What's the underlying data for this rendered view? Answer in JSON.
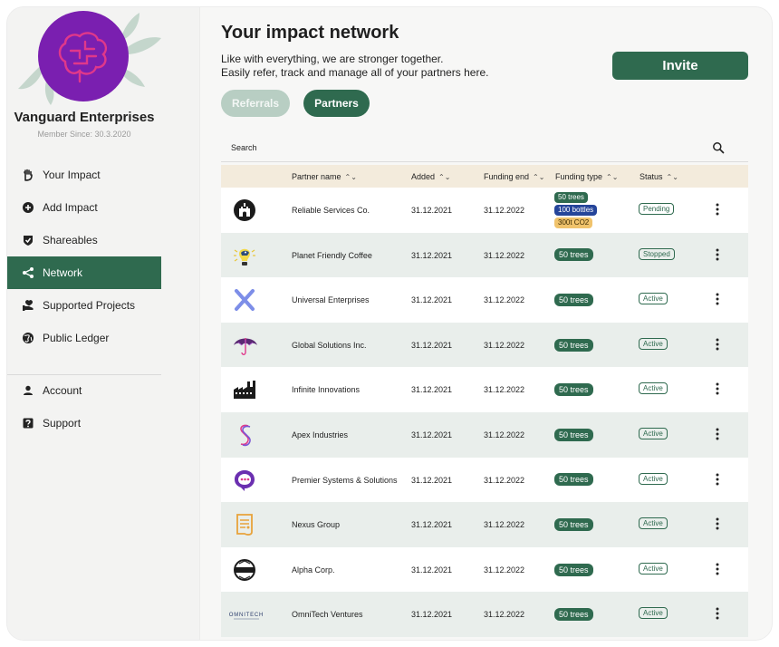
{
  "sidebar": {
    "company_name": "Vanguard Enterprises",
    "member_since": "Member Since: 30.3.2020",
    "nav": [
      {
        "label": "Your Impact",
        "icon": "hand-icon"
      },
      {
        "label": "Add Impact",
        "icon": "plus-circle-icon"
      },
      {
        "label": "Shareables",
        "icon": "shield-check-icon"
      },
      {
        "label": "Network",
        "icon": "share-icon",
        "active": true
      },
      {
        "label": "Supported Projects",
        "icon": "heart-hand-icon"
      },
      {
        "label": "Public Ledger",
        "icon": "globe-icon"
      }
    ],
    "nav_secondary": [
      {
        "label": "Account",
        "icon": "user-icon"
      },
      {
        "label": "Support",
        "icon": "help-icon"
      }
    ]
  },
  "main": {
    "title": "Your impact network",
    "subtitle_line1": "Like with everything, we are stronger together.",
    "subtitle_line2": "Easily refer, track and manage all of your partners here.",
    "invite_label": "Invite",
    "tabs": [
      {
        "label": "Referrals",
        "active": false
      },
      {
        "label": "Partners",
        "active": true
      }
    ],
    "search_label": "Search"
  },
  "table": {
    "columns": [
      "Partner name",
      "Added",
      "Funding end",
      "Funding type",
      "Status"
    ],
    "rows": [
      {
        "name": "Reliable Services Co.",
        "added": "31.12.2021",
        "end": "31.12.2022",
        "funding": [
          "50 trees",
          "100 bottles",
          "300t CO2"
        ],
        "status": "Pending",
        "logo": "castle-logo-icon"
      },
      {
        "name": "Planet Friendly Coffee",
        "added": "31.12.2021",
        "end": "31.12.2022",
        "funding": [
          "50 trees"
        ],
        "status": "Stopped",
        "logo": "bird-bulb-logo-icon"
      },
      {
        "name": "Universal Enterprises",
        "added": "31.12.2021",
        "end": "31.12.2022",
        "funding": [
          "50 trees"
        ],
        "status": "Active",
        "logo": "x-logo-icon"
      },
      {
        "name": "Global Solutions Inc.",
        "added": "31.12.2021",
        "end": "31.12.2022",
        "funding": [
          "50 trees"
        ],
        "status": "Active",
        "logo": "umbrella-logo-icon"
      },
      {
        "name": "Infinite Innovations",
        "added": "31.12.2021",
        "end": "31.12.2022",
        "funding": [
          "50 trees"
        ],
        "status": "Active",
        "logo": "factory-logo-icon"
      },
      {
        "name": "Apex Industries",
        "added": "31.12.2021",
        "end": "31.12.2022",
        "funding": [
          "50 trees"
        ],
        "status": "Active",
        "logo": "s-logo-icon"
      },
      {
        "name": "Premier Systems & Solutions",
        "added": "31.12.2021",
        "end": "31.12.2022",
        "funding": [
          "50 trees"
        ],
        "status": "Active",
        "logo": "chat-logo-icon"
      },
      {
        "name": "Nexus Group",
        "added": "31.12.2021",
        "end": "31.12.2022",
        "funding": [
          "50 trees"
        ],
        "status": "Active",
        "logo": "document-logo-icon"
      },
      {
        "name": "Alpha Corp.",
        "added": "31.12.2021",
        "end": "31.12.2022",
        "funding": [
          "50 trees"
        ],
        "status": "Active",
        "logo": "alpha-badge-logo-icon"
      },
      {
        "name": "OmniTech Ventures",
        "added": "31.12.2021",
        "end": "31.12.2022",
        "funding": [
          "50 trees"
        ],
        "status": "Active",
        "logo": "omnitech-wordmark-icon",
        "logo_text": "OMNITECH"
      }
    ]
  },
  "colors": {
    "brand_green": "#2f6a4f",
    "header_beige": "#f3ebdc",
    "logo_purple": "#7a1fb0",
    "logo_pink": "#e0388a"
  }
}
